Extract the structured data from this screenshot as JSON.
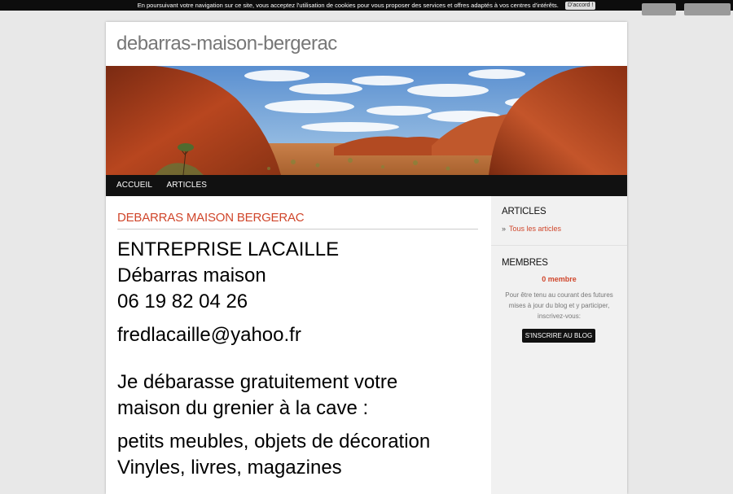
{
  "cookie_bar": {
    "message": "En poursuivant votre navigation sur ce site, vous acceptez l'utilisation de cookies pour vous proposer des services et offres adaptés à vos centres d'intérêts.",
    "accept_label": "D'accord !"
  },
  "site": {
    "title": "debarras-maison-bergerac"
  },
  "nav": {
    "items": [
      {
        "label": "ACCUEIL"
      },
      {
        "label": "ARTICLES"
      }
    ]
  },
  "post": {
    "title": "DEBARRAS MAISON BERGERAC",
    "lines": [
      "ENTREPRISE LACAILLE",
      "Débarras maison",
      "06 19 82 04 26",
      "fredlacaille@yahoo.fr",
      "Je  débarasse gratuitement votre",
      "maison du grenier  à la cave :",
      "petits meubles, objets de décoration",
      "Vinyles, livres, magazines"
    ]
  },
  "sidebar": {
    "articles": {
      "title": "ARTICLES",
      "link": "Tous les articles"
    },
    "members": {
      "title": "MEMBRES",
      "count": "0 membre",
      "text": "Pour être tenu au courant des futures mises à jour du blog et y participer, inscrivez-vous:",
      "button": "S'INSCRIRE AU BLOG"
    }
  },
  "colors": {
    "accent": "#d0462b",
    "nav_bg": "#111111",
    "page_bg": "#e8e8e8"
  }
}
